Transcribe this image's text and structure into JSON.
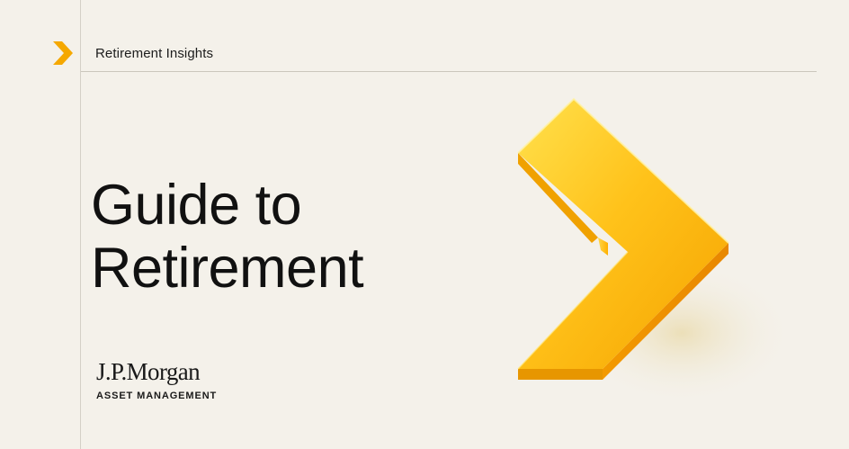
{
  "header": {
    "section_label": "Retirement Insights"
  },
  "title": {
    "line1": "Guide to",
    "line2": "Retirement"
  },
  "logo": {
    "name": "J.P.Morgan",
    "subtitle": "ASSET MANAGEMENT"
  },
  "decorations": {
    "small_chevron_icon": "chevron-right-icon",
    "hero_chevron_icon": "chevron-right-icon",
    "accent_color": "#f5a800",
    "accent_light": "#ffd23a",
    "background_color": "#f4f1ea"
  }
}
